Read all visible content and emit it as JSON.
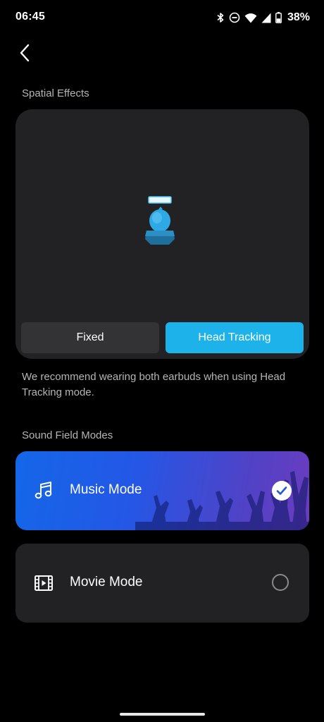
{
  "status_bar": {
    "time": "06:45",
    "battery": "38%",
    "icons": [
      "bluetooth-icon",
      "do-not-disturb-icon",
      "wifi-icon",
      "cell-signal-icon",
      "battery-icon"
    ]
  },
  "nav": {
    "back_icon": "chevron-left-icon"
  },
  "spatial": {
    "title": "Spatial Effects",
    "options": [
      {
        "label": "Fixed",
        "selected": false
      },
      {
        "label": "Head Tracking",
        "selected": true
      }
    ],
    "hint": "We recommend wearing both earbuds when using Head Tracking mode."
  },
  "sound_field": {
    "title": "Sound Field Modes",
    "modes": [
      {
        "label": "Music Mode",
        "icon": "music-note-icon",
        "selected": true
      },
      {
        "label": "Movie Mode",
        "icon": "film-icon",
        "selected": false
      }
    ]
  },
  "colors": {
    "accent": "#1db3ea",
    "card_bg": "#222225",
    "music_gradient_start": "#1467e8",
    "music_gradient_end": "#6b3cbf"
  }
}
